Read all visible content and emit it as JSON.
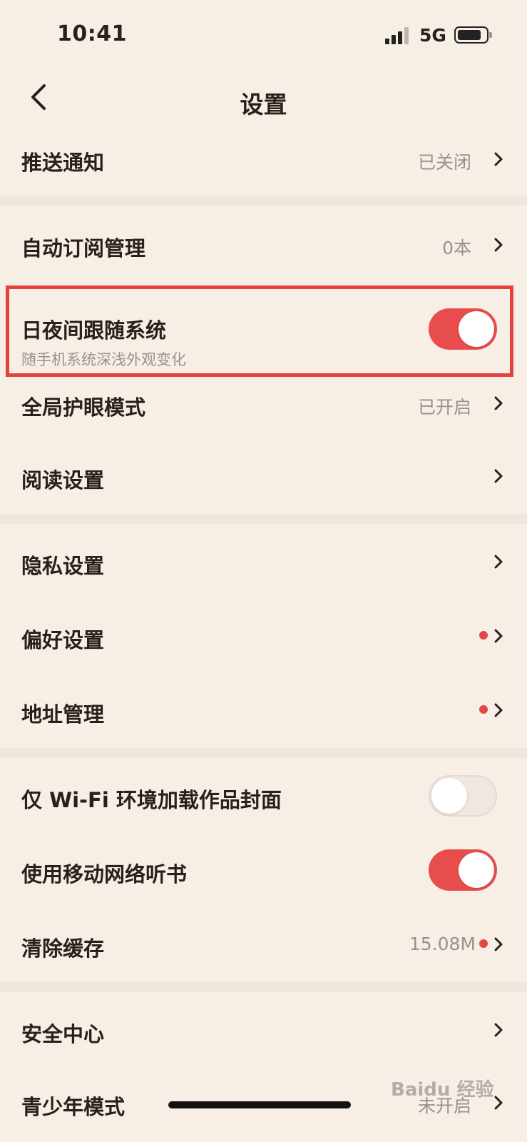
{
  "status_bar": {
    "time": "10:41",
    "network": "5G"
  },
  "nav": {
    "title": "设置"
  },
  "rows": {
    "push": {
      "label": "推送通知",
      "value": "已关闭"
    },
    "auto_sub": {
      "label": "自动订阅管理",
      "value": "0本"
    },
    "day_night": {
      "label": "日夜间跟随系统",
      "subtitle": "随手机系统深浅外观变化",
      "toggle": true
    },
    "eye_care": {
      "label": "全局护眼模式",
      "value": "已开启"
    },
    "reading": {
      "label": "阅读设置"
    },
    "privacy": {
      "label": "隐私设置"
    },
    "preference": {
      "label": "偏好设置",
      "badge": true
    },
    "address": {
      "label": "地址管理",
      "badge": true
    },
    "wifi_cover": {
      "label": "仅 Wi-Fi 环境加载作品封面",
      "toggle": false
    },
    "mobile_listen": {
      "label": "使用移动网络听书",
      "toggle": true
    },
    "cache": {
      "label": "清除缓存",
      "value": "15.08M",
      "badge": true
    },
    "security": {
      "label": "安全中心"
    },
    "youth": {
      "label": "青少年模式",
      "value": "未开启"
    }
  },
  "watermark": "Baidu 经验",
  "colors": {
    "accent": "#e84d4d",
    "background": "#f7efe6",
    "highlight_border": "#e6413b"
  }
}
